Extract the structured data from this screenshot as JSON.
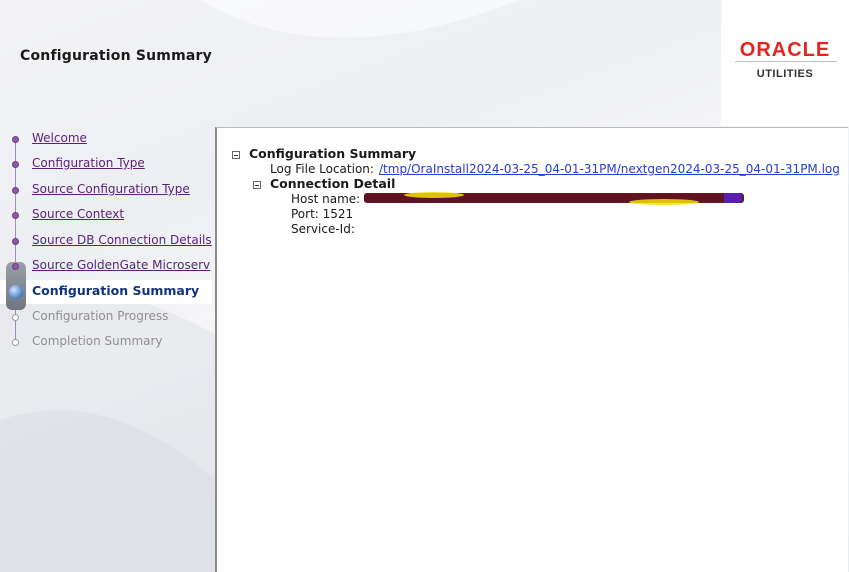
{
  "header": {
    "title": "Configuration Summary"
  },
  "logo": {
    "brand": "ORACLE",
    "sub": "UTILITIES",
    "brand_color": "#e02620"
  },
  "steps": [
    {
      "label": "Welcome",
      "state": "done"
    },
    {
      "label": "Configuration Type",
      "state": "done"
    },
    {
      "label": "Source Configuration Type",
      "state": "done"
    },
    {
      "label": "Source Context",
      "state": "done"
    },
    {
      "label": "Source DB Connection Details",
      "state": "done"
    },
    {
      "label": "Source GoldenGate Microserv",
      "state": "done"
    },
    {
      "label": "Configuration Summary",
      "state": "current"
    },
    {
      "label": "Configuration Progress",
      "state": "future"
    },
    {
      "label": "Completion Summary",
      "state": "future"
    }
  ],
  "summary": {
    "title": "Configuration Summary",
    "log_label": "Log File Location:",
    "log_path": "/tmp/OraInstall2024-03-25_04-01-31PM/nextgen2024-03-25_04-01-31PM.log",
    "connection": {
      "title": "Connection Detail",
      "host_label": "Host name:",
      "port_text": "Port: 1521",
      "service_label": "Service-Id:"
    }
  }
}
